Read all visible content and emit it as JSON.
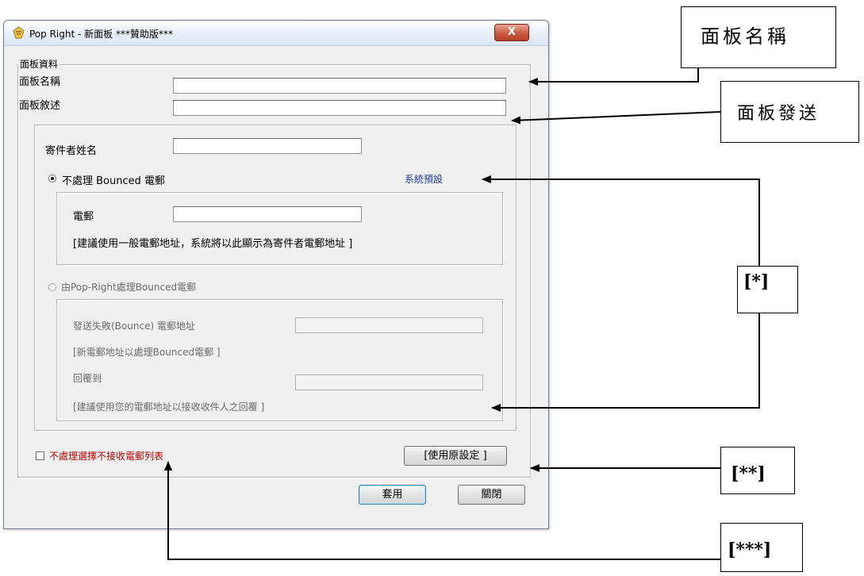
{
  "window": {
    "title": "Pop Right - 新面板 ***贊助版***",
    "close_label": "X"
  },
  "panel_info": {
    "legend": "面板資料",
    "name_label": "面板名稱",
    "name_value": "",
    "desc_label": "面板敘述",
    "desc_value": ""
  },
  "sender": {
    "name_label": "寄件者姓名",
    "name_value": ""
  },
  "option_no_bounce": {
    "label": "不處理 Bounced 電郵",
    "selected": true,
    "system_default_link": "系統預設",
    "email_label": "電郵",
    "email_value": "",
    "hint": "[建議使用一般電郵地址，系統將以此顯示為寄件者電郵地址 ]"
  },
  "option_pop_right": {
    "label": "由Pop-Right處理Bounced電郵",
    "selected": false,
    "bounce_label": "發送失敗(Bounce) 電郵地址",
    "bounce_value": "",
    "bounce_hint": "[新電郵地址以處理Bounced電郵 ]",
    "reply_label": "回覆到",
    "reply_value": "",
    "reply_hint": "[建議使用您的電郵地址以接收收件人之回覆 ]"
  },
  "unsubscribe": {
    "label": "不處理選擇不接收電郵列表",
    "checked": false,
    "label_color": "#c00000"
  },
  "buttons": {
    "use_default": "[使用原設定 ]",
    "apply": "套用",
    "close": "關閉"
  },
  "annotations": {
    "panel_name": "面板名稱",
    "panel_send": "面板發送",
    "single": "[*]",
    "double": "[**]",
    "triple": "[***]"
  },
  "colors": {
    "link": "#1f3fa6",
    "window_bg": "#f0f0f0",
    "close_button": "#c85b43"
  }
}
